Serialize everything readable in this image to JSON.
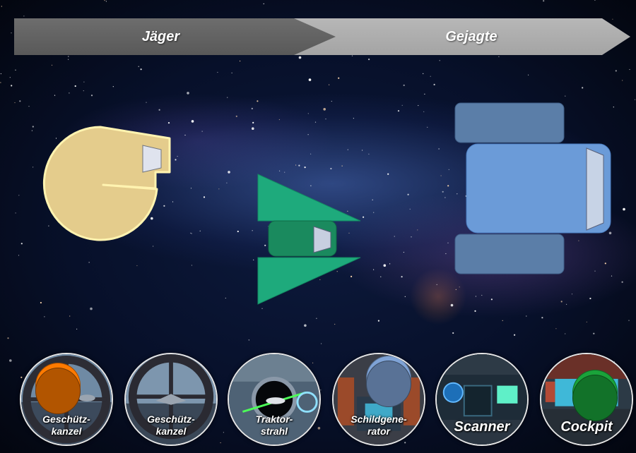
{
  "phases": {
    "hunter_label": "Jäger",
    "hunted_label": "Gejagte"
  },
  "ships": {
    "hunter_color": "#e4cc8c",
    "interceptor_color": "#1eaa7c",
    "prey_color": "#6b9bd8"
  },
  "stations": [
    {
      "id": "gun-turret-1",
      "label": "Geschütz-\nkanzel",
      "token_color": "#ff7a00"
    },
    {
      "id": "gun-turret-2",
      "label": "Geschütz-\nkanzel",
      "token_color": null
    },
    {
      "id": "tractor-beam",
      "label": "Traktor-\nstrahl",
      "token_color": null
    },
    {
      "id": "shield-generator",
      "label": "Schildgene-\nrator",
      "token_color": "#7fa3d6"
    },
    {
      "id": "scanner",
      "label": "Scanner",
      "token_color": null
    },
    {
      "id": "cockpit",
      "label": "Cockpit",
      "token_color": "#1aa33a"
    }
  ]
}
